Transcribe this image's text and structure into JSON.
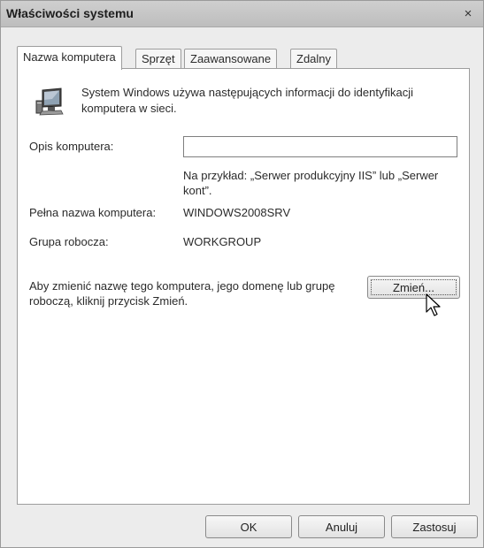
{
  "window": {
    "title": "Właściwości systemu",
    "close_label": "×"
  },
  "tabs": [
    {
      "label": "Nazwa komputera",
      "active": true
    },
    {
      "label": "Sprzęt",
      "active": false
    },
    {
      "label": "Zaawansowane",
      "active": false
    },
    {
      "label": "Zdalny",
      "active": false
    }
  ],
  "panel": {
    "icon": "computer-icon",
    "info_text": "System Windows używa następujących informacji do identyfikacji komputera w sieci.",
    "description_label": "Opis komputera:",
    "description_value": "",
    "example_text": "Na przykład: „Serwer produkcyjny IIS” lub „Serwer kont”.",
    "full_name_label": "Pełna nazwa komputera:",
    "full_name_value": "WINDOWS2008SRV",
    "workgroup_label": "Grupa robocza:",
    "workgroup_value": "WORKGROUP",
    "rename_text": "Aby zmienić nazwę tego komputera, jego domenę lub grupę roboczą, kliknij przycisk Zmień.",
    "change_button": "Zmień..."
  },
  "footer": {
    "ok": "OK",
    "cancel": "Anuluj",
    "apply": "Zastosuj"
  }
}
